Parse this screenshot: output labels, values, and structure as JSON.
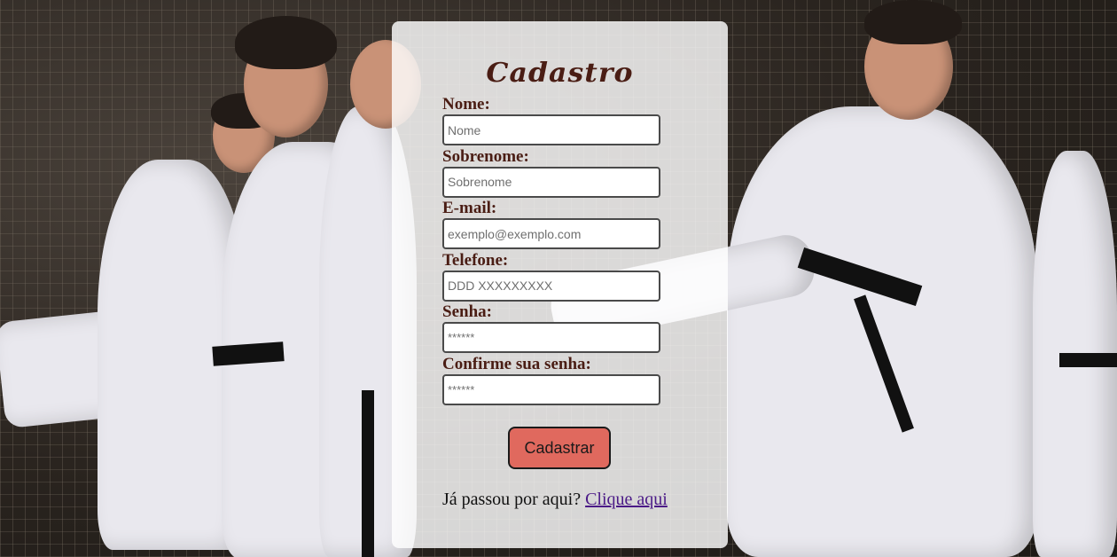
{
  "page": {
    "title": "Cadastro"
  },
  "form": {
    "fields": [
      {
        "label": "Nome:",
        "placeholder": "Nome",
        "type": "text"
      },
      {
        "label": "Sobrenome:",
        "placeholder": "Sobrenome",
        "type": "text"
      },
      {
        "label": "E-mail:",
        "placeholder": "exemplo@exemplo.com",
        "type": "email"
      },
      {
        "label": "Telefone:",
        "placeholder": "DDD XXXXXXXXX",
        "type": "tel"
      },
      {
        "label": "Senha:",
        "placeholder": "******",
        "type": "password"
      },
      {
        "label": "Confirme sua senha:",
        "placeholder": "******",
        "type": "password"
      }
    ],
    "submit_label": "Cadastrar"
  },
  "footer": {
    "prompt": "Já passou por aqui?",
    "link_text": "Clique aqui"
  },
  "colors": {
    "label_text": "#4a1d14",
    "submit_bg": "#e0695e",
    "link": "#4b1a87"
  },
  "background": {
    "description_icon": "karate-photo"
  }
}
